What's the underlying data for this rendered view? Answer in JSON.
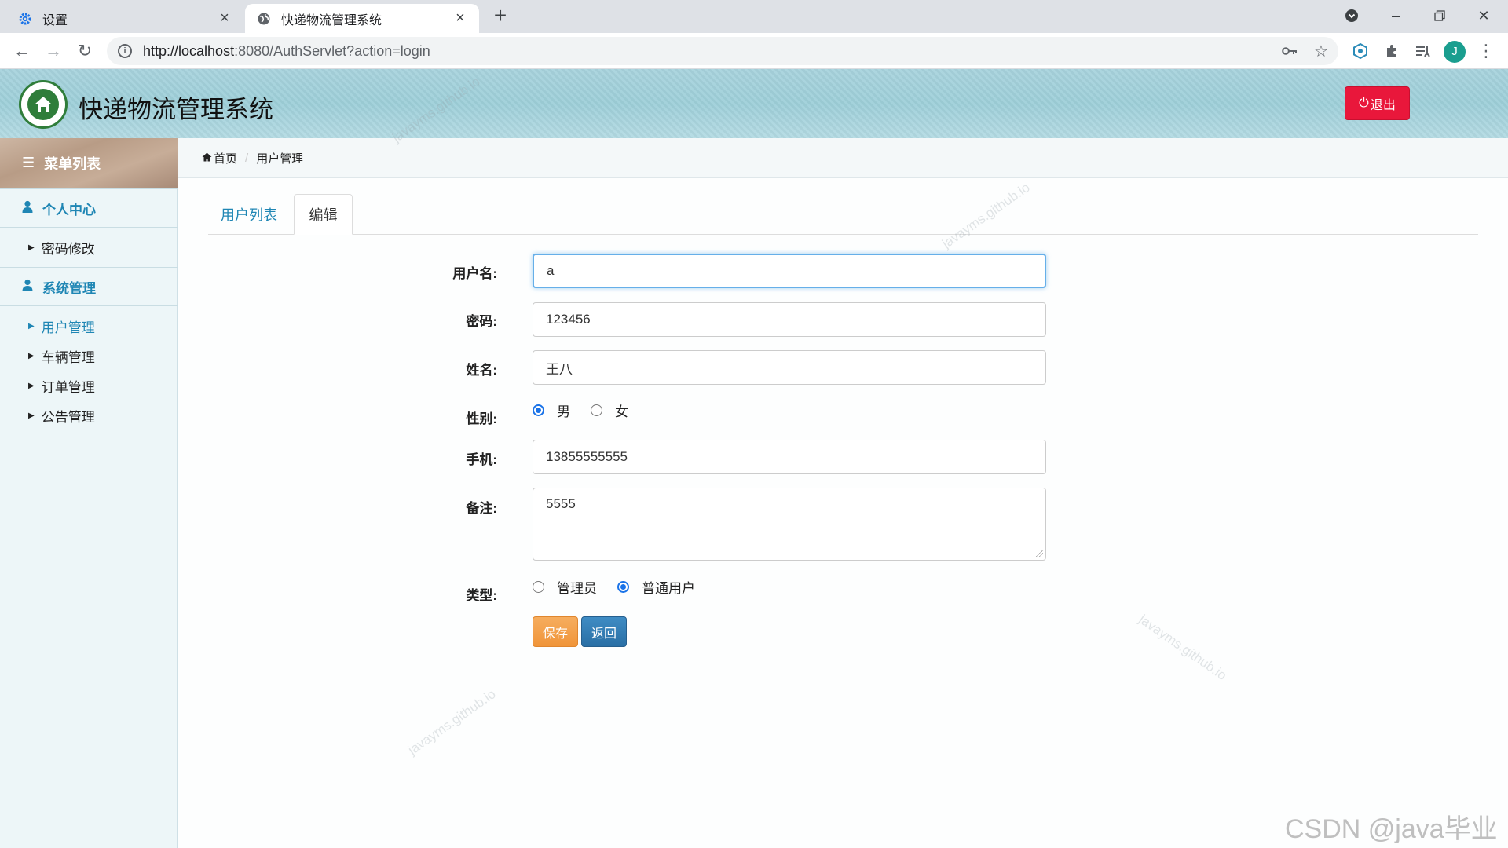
{
  "browser": {
    "tabs": [
      {
        "title": "设置"
      },
      {
        "title": "快递物流管理系统"
      }
    ],
    "url_host": "http://localhost",
    "url_rest": ":8080/AuthServlet?action=login",
    "avatar_letter": "J"
  },
  "header": {
    "title": "快递物流管理系统",
    "logout_label": "退出"
  },
  "sidebar": {
    "heading": "菜单列表",
    "sections": [
      {
        "label": "个人中心",
        "items": [
          "密码修改"
        ]
      },
      {
        "label": "系统管理",
        "items": [
          "用户管理",
          "车辆管理",
          "订单管理",
          "公告管理"
        ]
      }
    ],
    "active_item": "用户管理"
  },
  "breadcrumb": {
    "home": "首页",
    "current": "用户管理"
  },
  "tabs": {
    "list_label": "用户列表",
    "edit_label": "编辑",
    "active": "编辑"
  },
  "form": {
    "username_label": "用户名:",
    "username_value": "a",
    "password_label": "密码:",
    "password_value": "123456",
    "name_label": "姓名:",
    "name_value": "王八",
    "gender_label": "性别:",
    "gender_options": [
      "男",
      "女"
    ],
    "gender_selected": "男",
    "phone_label": "手机:",
    "phone_value": "13855555555",
    "remark_label": "备注:",
    "remark_value": "5555",
    "type_label": "类型:",
    "type_options": [
      "管理员",
      "普通用户"
    ],
    "type_selected": "普通用户",
    "save_label": "保存",
    "back_label": "返回"
  },
  "watermarks": {
    "site": "javayms.github.io",
    "csdn": "CSDN @java毕业"
  },
  "colors": {
    "accent": "#1f86b4",
    "logout": "#e9173b",
    "save": "#f0953a",
    "back": "#2a6fa5"
  }
}
